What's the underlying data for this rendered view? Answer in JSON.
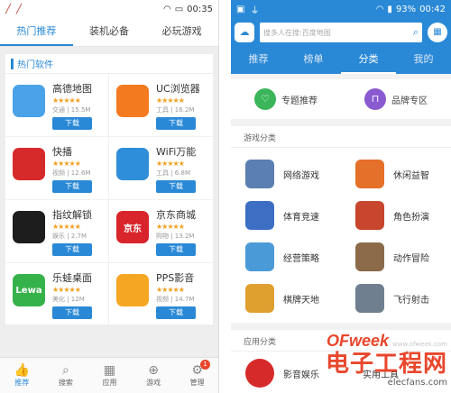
{
  "left_phone": {
    "status": {
      "time": "00:35"
    },
    "tabs": [
      {
        "label": "热门推荐",
        "active": true
      },
      {
        "label": "装机必备",
        "active": false
      },
      {
        "label": "必玩游戏",
        "active": false
      }
    ],
    "section_title": "热门软件",
    "apps": [
      {
        "name": "高德地图",
        "stars": "★★★★★",
        "meta": "交通 | 15.5M",
        "button": "下载",
        "icon": "navigation-arrow-icon",
        "color": "#4aa3e8"
      },
      {
        "name": "UC浏览器",
        "stars": "★★★★★",
        "meta": "工具 | 16.2M",
        "button": "下载",
        "icon": "squirrel-icon",
        "color": "#f47a20"
      },
      {
        "name": "快播",
        "stars": "★★★★★",
        "meta": "视频 | 12.6M",
        "button": "下载",
        "icon": "play-q-icon",
        "color": "#d62a2a"
      },
      {
        "name": "WiFi万能",
        "stars": "★★★★★",
        "meta": "工具 | 6.8M",
        "button": "下载",
        "icon": "wifi-key-icon",
        "color": "#2f8ed9"
      },
      {
        "name": "指纹解锁",
        "stars": "★★★★★",
        "meta": "娱乐 | 2.7M",
        "button": "下载",
        "icon": "fingerprint-icon",
        "color": "#1d1d1d"
      },
      {
        "name": "京东商城",
        "stars": "★★★★★",
        "meta": "购物 | 13.2M",
        "button": "下载",
        "icon": "jd-logo-icon",
        "color": "#d8252b",
        "icon_text": "京东"
      },
      {
        "name": "乐蛙桌面",
        "stars": "★★★★★",
        "meta": "美化 | 12M",
        "button": "下载",
        "icon": "lewa-icon",
        "color": "#36b24a",
        "icon_text": "Lewa"
      },
      {
        "name": "PPS影音",
        "stars": "★★★★★",
        "meta": "视频 | 14.7M",
        "button": "下载",
        "icon": "pps-face-icon",
        "color": "#f5a623"
      }
    ],
    "bottom_nav": [
      {
        "label": "推荐",
        "icon": "thumbs-up-icon",
        "glyph": "👍",
        "active": true
      },
      {
        "label": "搜索",
        "icon": "search-icon",
        "glyph": "⌕",
        "active": false
      },
      {
        "label": "应用",
        "icon": "apps-grid-icon",
        "glyph": "▦",
        "active": false
      },
      {
        "label": "游戏",
        "icon": "gamepad-icon",
        "glyph": "⊕",
        "active": false
      },
      {
        "label": "管理",
        "icon": "gear-icon",
        "glyph": "⚙",
        "active": false,
        "badge": "1"
      }
    ]
  },
  "right_phone": {
    "status": {
      "battery": "93%",
      "time": "00:42"
    },
    "search": {
      "placeholder": "搜多人在搜:百度地图"
    },
    "tabs": [
      {
        "label": "推荐",
        "active": false
      },
      {
        "label": "榜单",
        "active": false
      },
      {
        "label": "分类",
        "active": true
      },
      {
        "label": "我的",
        "active": false
      }
    ],
    "quick_links": [
      {
        "label": "专题推荐",
        "icon": "heart-icon",
        "glyph": "♡",
        "color": "#3bb55a"
      },
      {
        "label": "品牌专区",
        "icon": "bookmark-icon",
        "glyph": "⊓",
        "color": "#8a5ad0"
      }
    ],
    "game_section_title": "游戏分类",
    "game_categories": [
      {
        "label": "网络游戏",
        "color": "#5a7fb0"
      },
      {
        "label": "休闲益智",
        "color": "#e4702a"
      },
      {
        "label": "体育竞速",
        "color": "#3c6fc4"
      },
      {
        "label": "角色扮演",
        "color": "#c8452e"
      },
      {
        "label": "经营策略",
        "color": "#4a9ad8"
      },
      {
        "label": "动作冒险",
        "color": "#8b6b4a"
      },
      {
        "label": "棋牌天地",
        "color": "#e0a030"
      },
      {
        "label": "飞行射击",
        "color": "#6f7f8f"
      }
    ],
    "app_section_title": "应用分类",
    "app_categories": [
      {
        "label": "影音娱乐",
        "color": "#d62a2a"
      },
      {
        "label": "实用工具",
        "color": "#3a88d8"
      }
    ]
  },
  "watermark": {
    "brand": "OFweek",
    "url": "www.ofweek.com",
    "title": "电子工程网",
    "sub": "elecfans.com"
  }
}
